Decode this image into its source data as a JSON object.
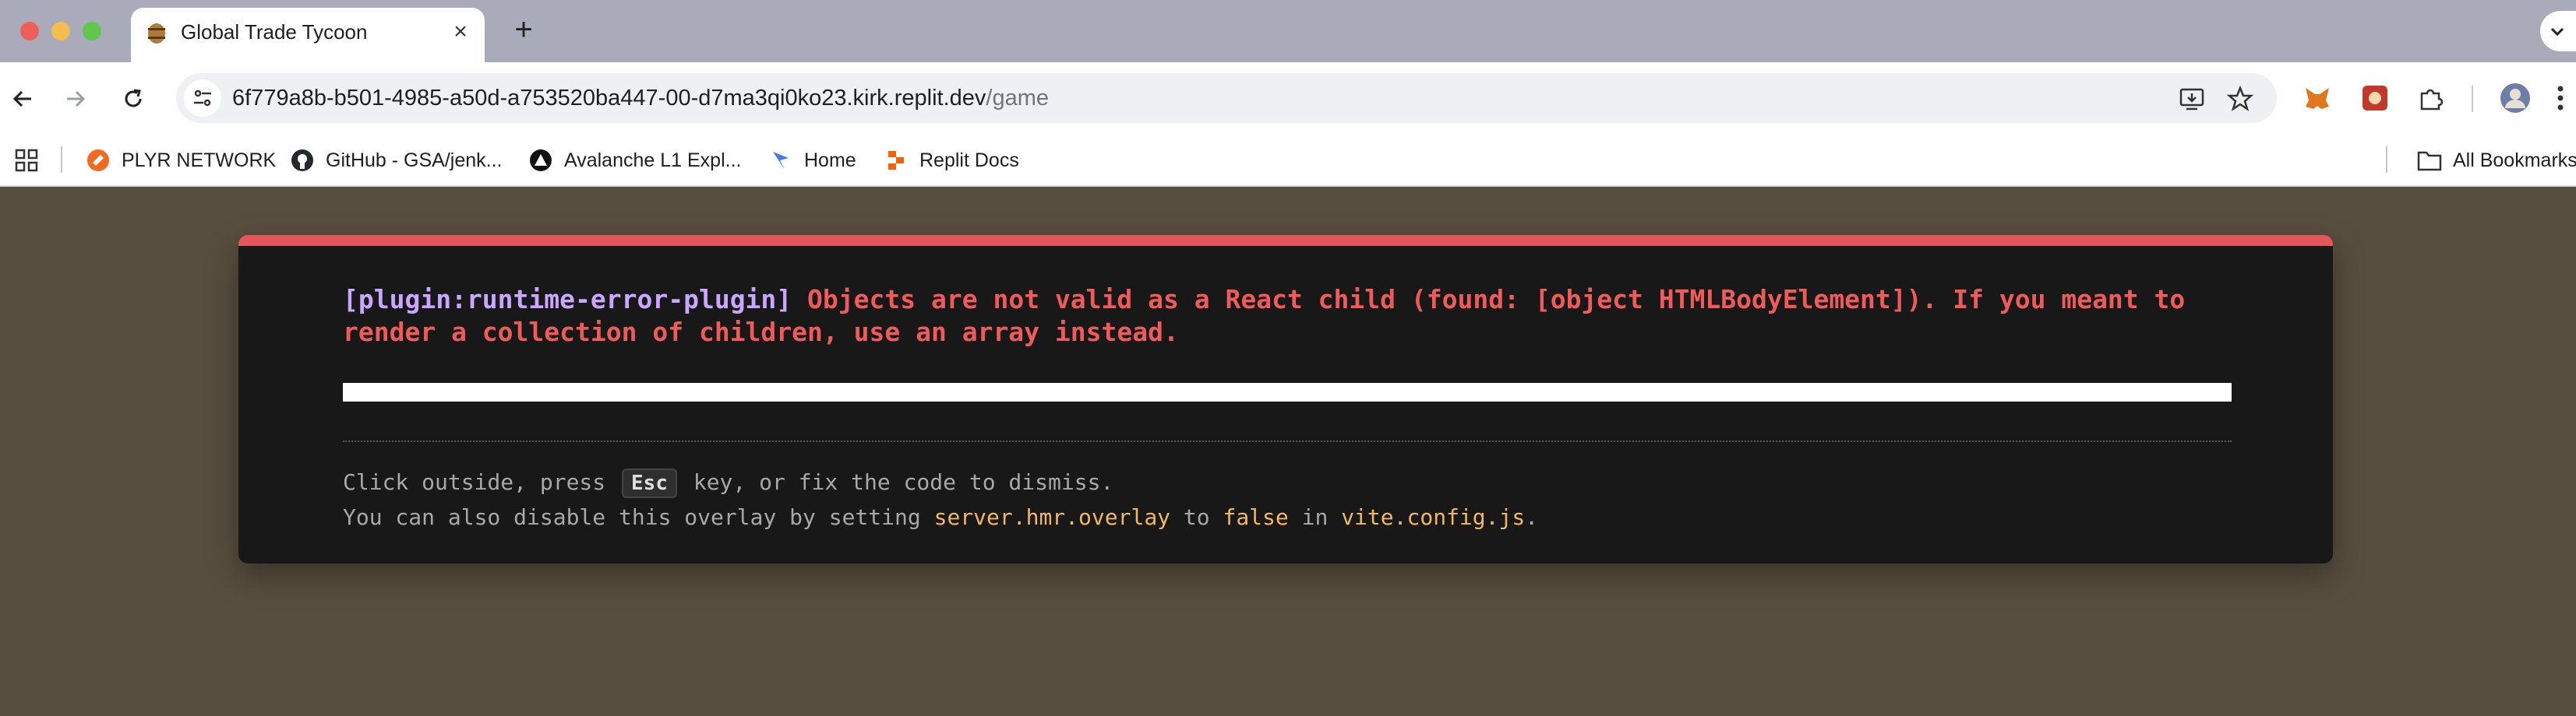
{
  "browser": {
    "tab": {
      "title": "Global Trade Tycoon",
      "favicon": "barrel-icon"
    },
    "url": {
      "host": "6f779a8b-b501-4985-a50d-a753520ba447-00-d7ma3qi0ko23.kirk.replit.dev",
      "path": "/game"
    },
    "bookmarks": [
      {
        "label": "PLYR NETWORK",
        "icon": "plyr-icon"
      },
      {
        "label": "GitHub - GSA/jenk...",
        "icon": "github-icon"
      },
      {
        "label": "Avalanche L1 Expl...",
        "icon": "avalanche-icon"
      },
      {
        "label": "Home",
        "icon": "home-logo-icon"
      },
      {
        "label": "Replit Docs",
        "icon": "replit-icon"
      }
    ],
    "all_bookmarks_label": "All Bookmarks"
  },
  "overlay": {
    "plugin": "[plugin:runtime-error-plugin]",
    "message": "Objects are not valid as a React child (found: [object HTMLBodyElement]). If you meant to render a collection of children, use an array instead.",
    "tip1": {
      "before": "Click outside, press",
      "key": "Esc",
      "after": "key, or fix the code to dismiss."
    },
    "tip2": {
      "before": "You can also disable this overlay by setting",
      "setting": "server.hmr.overlay",
      "mid": "to",
      "value": "false",
      "in": "in",
      "file": "vite.config.js",
      "end": "."
    }
  },
  "colors": {
    "accent_error": "#e3565b",
    "plugin_text": "#c9a6ff",
    "code_text": "#f0b860",
    "page_bg": "#584e3f"
  }
}
